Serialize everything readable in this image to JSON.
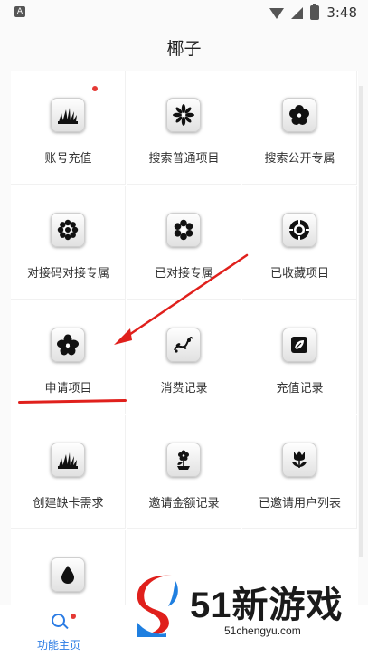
{
  "status_bar": {
    "time": "3:48",
    "notification_icon": "A"
  },
  "header": {
    "title": "椰子"
  },
  "grid": {
    "items": [
      {
        "label": "账号充值",
        "icon": "grass-icon",
        "has_badge": true
      },
      {
        "label": "搜索普通项目",
        "icon": "star-flower-icon",
        "has_badge": false
      },
      {
        "label": "搜索公开专属",
        "icon": "five-petal-flower-icon",
        "has_badge": false
      },
      {
        "label": "对接码对接专属",
        "icon": "daisy-icon",
        "has_badge": false
      },
      {
        "label": "已对接专属",
        "icon": "round-flower-icon",
        "has_badge": false
      },
      {
        "label": "已收藏项目",
        "icon": "sun-flower-icon",
        "has_badge": false
      },
      {
        "label": "申请项目",
        "icon": "flower-icon",
        "has_badge": false
      },
      {
        "label": "消费记录",
        "icon": "vine-icon",
        "has_badge": false
      },
      {
        "label": "充值记录",
        "icon": "leaf-square-icon",
        "has_badge": false
      },
      {
        "label": "创建缺卡需求",
        "icon": "grass-icon",
        "has_badge": false
      },
      {
        "label": "邀请金额记录",
        "icon": "potted-flower-icon",
        "has_badge": false
      },
      {
        "label": "已邀请用户列表",
        "icon": "tulip-icon",
        "has_badge": false
      },
      {
        "label": "",
        "icon": "drop-icon",
        "has_badge": false
      }
    ]
  },
  "bottom_nav": {
    "home_label": "功能主页",
    "home_icon": "search-icon",
    "has_badge": true
  },
  "watermark": {
    "brand": "51新游戏",
    "url": "51chengyu.com"
  },
  "colors": {
    "accent": "#2a7be4",
    "badge": "#e53935",
    "annotation": "#e0201c"
  }
}
